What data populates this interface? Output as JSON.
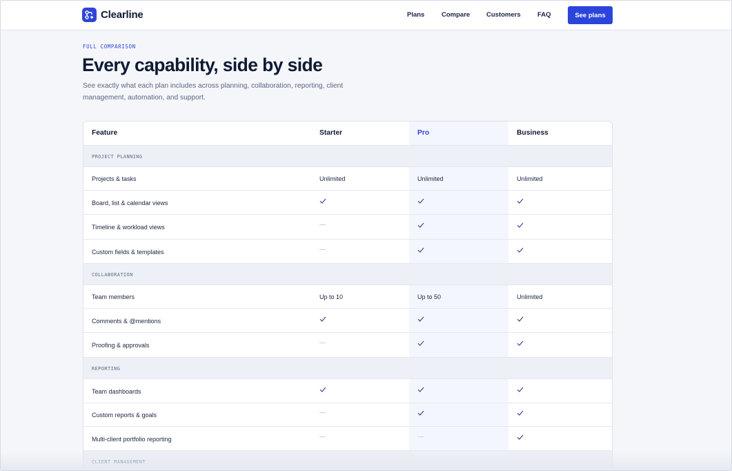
{
  "nav": {
    "brand": "Clearline",
    "links": [
      "Plans",
      "Compare",
      "Customers",
      "FAQ"
    ],
    "cta": "See plans"
  },
  "hero": {
    "eyebrow": "FULL COMPARISON",
    "title": "Every capability, side by side",
    "subtitle": "See exactly what each plan includes across planning, collaboration, reporting, client management, automation, and support."
  },
  "table": {
    "headers": [
      "Feature",
      "Starter",
      "Pro",
      "Business"
    ],
    "highlight_plan": "Pro",
    "sections": [
      {
        "label": "PROJECT PLANNING",
        "rows": [
          {
            "feature": "Projects & tasks",
            "values": [
              "Unlimited",
              "Unlimited",
              "Unlimited"
            ]
          },
          {
            "feature": "Board, list & calendar views",
            "values": [
              "check",
              "check",
              "check"
            ]
          },
          {
            "feature": "Timeline & workload views",
            "values": [
              "none",
              "check",
              "check"
            ]
          },
          {
            "feature": "Custom fields & templates",
            "values": [
              "none",
              "check",
              "check"
            ]
          }
        ]
      },
      {
        "label": "COLLABORATION",
        "rows": [
          {
            "feature": "Team members",
            "values": [
              "Up to 10",
              "Up to 50",
              "Unlimited"
            ]
          },
          {
            "feature": "Comments & @mentions",
            "values": [
              "check",
              "check",
              "check"
            ]
          },
          {
            "feature": "Proofing & approvals",
            "values": [
              "none",
              "check",
              "check"
            ]
          }
        ]
      },
      {
        "label": "REPORTING",
        "rows": [
          {
            "feature": "Team dashboards",
            "values": [
              "check",
              "check",
              "check"
            ]
          },
          {
            "feature": "Custom reports & goals",
            "values": [
              "none",
              "check",
              "check"
            ]
          },
          {
            "feature": "Multi-client portfolio reporting",
            "values": [
              "none",
              "none",
              "check"
            ]
          }
        ]
      },
      {
        "label": "CLIENT MANAGEMENT",
        "rows": []
      }
    ]
  },
  "colors": {
    "accent": "#2b44db",
    "check": "#3b4a8a",
    "dash": "#c9ced8",
    "pro_column_bg": "#f3f7fd",
    "section_bg": "#edf0f6"
  },
  "icons": {
    "included": "check-icon",
    "not_included": "dash-icon",
    "brand": "clearline-logo-icon"
  }
}
